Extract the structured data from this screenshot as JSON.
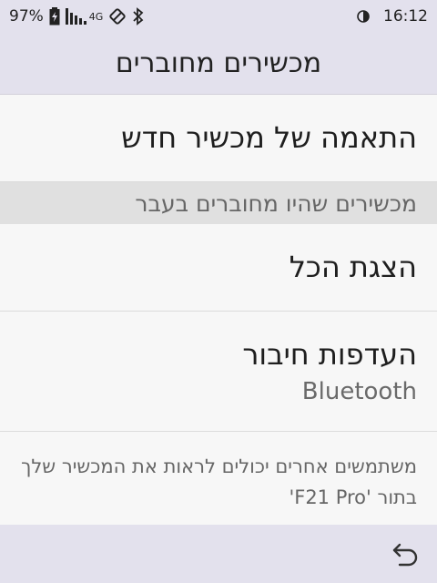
{
  "status_bar": {
    "battery_percent": "97%",
    "network_type": "4G",
    "time": "16:12",
    "icons": [
      "battery-icon",
      "signal-icon",
      "rotation-lock-icon",
      "bluetooth-icon",
      "data-saver-icon"
    ]
  },
  "app_bar": {
    "title": "מכשירים מחוברים"
  },
  "list": {
    "pair_new": "התאמה של מכשיר חדש",
    "section_header": "מכשירים שהיו מחוברים בעבר",
    "show_all": "הצגת הכל",
    "connection_prefs": {
      "title": "העדפות חיבור",
      "subtitle": "Bluetooth"
    },
    "visibility_note": "משתמשים אחרים יכולים לראות את המכשיר שלך בתור 'F21 Pro'"
  },
  "nav_bar": {
    "back_icon": "back-icon"
  },
  "colors": {
    "header_bg": "#e3e1ed",
    "section_bg": "#e0e0e0",
    "page_bg": "#f7f7f7"
  }
}
